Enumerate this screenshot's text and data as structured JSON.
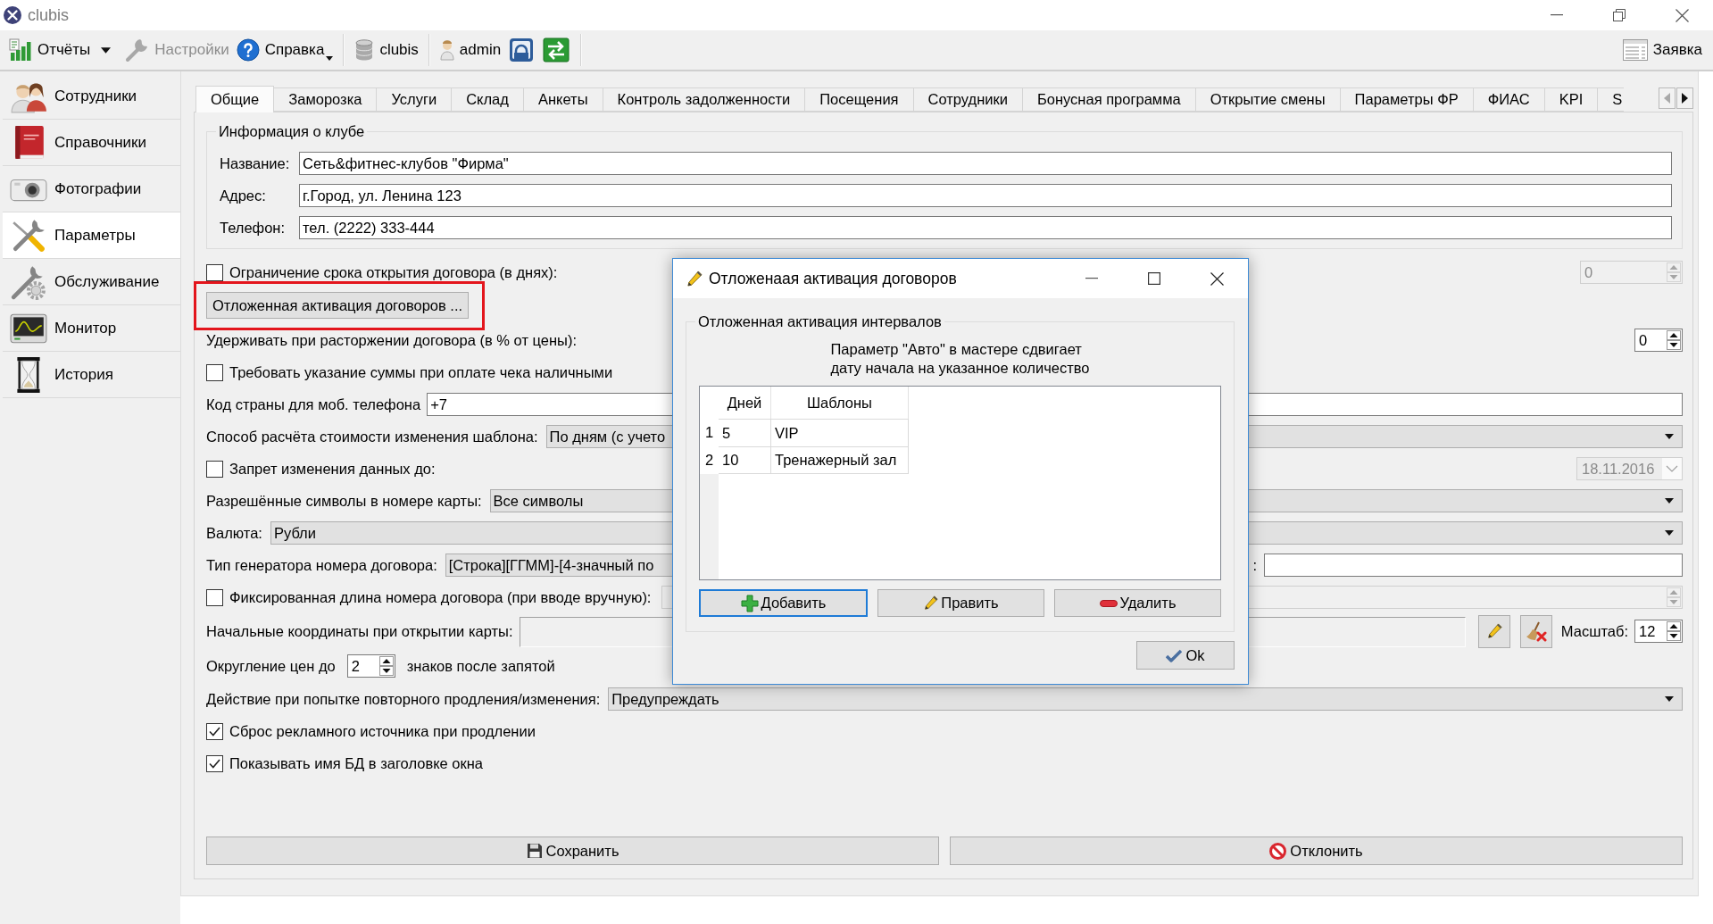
{
  "window": {
    "title": "clubis"
  },
  "toolbar": {
    "items": [
      {
        "kind": "split",
        "label": "Отчёты",
        "disabled": false,
        "separator_before": false
      },
      {
        "kind": "plain",
        "label": "Настройки",
        "disabled": true,
        "separator_before": false
      },
      {
        "kind": "menu",
        "label": "Справка",
        "disabled": false,
        "separator_before": false
      },
      {
        "kind": "plain",
        "label": "clubis",
        "disabled": false,
        "separator_before": true
      },
      {
        "kind": "plain",
        "label": "admin",
        "disabled": false,
        "separator_before": true
      }
    ],
    "request": {
      "label": "Заявка"
    }
  },
  "sidebar": {
    "items": [
      {
        "label": "Сотрудники",
        "selected": false
      },
      {
        "label": "Справочники",
        "selected": false
      },
      {
        "label": "Фотографии",
        "selected": false
      },
      {
        "label": "Параметры",
        "selected": true
      },
      {
        "label": "Обслуживание",
        "selected": false
      },
      {
        "label": "Монитор",
        "selected": false
      },
      {
        "label": "История",
        "selected": false
      }
    ]
  },
  "tabs": {
    "items": [
      {
        "label": "Общие",
        "selected": true
      },
      {
        "label": "Заморозка",
        "selected": false
      },
      {
        "label": "Услуги",
        "selected": false
      },
      {
        "label": "Склад",
        "selected": false
      },
      {
        "label": "Анкеты",
        "selected": false
      },
      {
        "label": "Контроль задолженности",
        "selected": false
      },
      {
        "label": "Посещения",
        "selected": false
      },
      {
        "label": "Сотрудники",
        "selected": false
      },
      {
        "label": "Бонусная программа",
        "selected": false
      },
      {
        "label": "Открытие смены",
        "selected": false
      },
      {
        "label": "Параметры ФР",
        "selected": false
      },
      {
        "label": "ФИАС",
        "selected": false
      },
      {
        "label": "KPI",
        "selected": false
      },
      {
        "label": "S",
        "selected": false
      }
    ],
    "scroll_left_enabled": false,
    "scroll_right_enabled": true
  },
  "club_info": {
    "title": "Информация о клубе",
    "fields": [
      {
        "label": "Название:",
        "value": "Сеть&фитнес-клубов \"Фирма\""
      },
      {
        "label": "Адрес:",
        "value": "г.Город, ул. Ленина 123"
      },
      {
        "label": "Телефон:",
        "value": "тел. (2222) 333-444"
      }
    ]
  },
  "settings": [
    {
      "kind": "check",
      "label": "Ограничение срока открытия договора (в днях):",
      "checked": false,
      "spin": {
        "value": "0",
        "disabled": true
      }
    },
    {
      "kind": "button",
      "label": "Отложенная активация договоров ...",
      "highlighted": true
    },
    {
      "kind": "spin",
      "label": "Удерживать при расторжении договора (в % от цены):",
      "spin": {
        "value": "0",
        "disabled": false
      }
    },
    {
      "kind": "check",
      "label": "Требовать указание суммы при оплате чека наличными",
      "checked": false
    },
    {
      "kind": "text",
      "label": "Код страны для моб. телефона",
      "value": "+7"
    },
    {
      "kind": "combo",
      "label": "Способ расчёта стоимости изменения шаблона:",
      "value": "По дням (с учето"
    },
    {
      "kind": "check",
      "label": "Запрет изменения данных до:",
      "checked": false,
      "date": {
        "value": "18.11.2016",
        "disabled": true
      }
    },
    {
      "kind": "combo",
      "label": "Разрешённые символы в номере карты:",
      "value": "Все символы"
    },
    {
      "kind": "combo",
      "label": "Валюта:",
      "value": "Рубли"
    },
    {
      "kind": "combo",
      "label": "Тип генератора номера договора:",
      "value": "[Строка][ГГММ]-[4-значный по",
      "side_field": {
        "label": ":"
      }
    },
    {
      "kind": "check_field",
      "label": "Фиксированная длина номера договора (при вводе вручную):",
      "checked": false,
      "spin": {
        "disabled": true
      }
    },
    {
      "kind": "coords",
      "label": "Начальные координаты при открытии карты:",
      "scale_label": "Масштаб:",
      "scale": "12"
    },
    {
      "kind": "rounding",
      "label": "Округление цен до",
      "value": "2",
      "suffix": "знаков после запятой"
    },
    {
      "kind": "combo",
      "label": "Действие при попытке повторного продления/изменения:",
      "value": "Предупреждать"
    },
    {
      "kind": "check",
      "label": "Сброс рекламного источника при продлении",
      "checked": true
    },
    {
      "kind": "check",
      "label": "Показывать имя БД в заголовке окна",
      "checked": true
    }
  ],
  "buttons": [
    {
      "kind": "save",
      "label": "Сохранить"
    },
    {
      "kind": "cancel",
      "label": "Отклонить"
    }
  ],
  "dialog": {
    "title": "Отложенаая активация договоров",
    "group": {
      "title": "Отложенная активация интервалов",
      "note": "Параметр \"Авто\" в мастере сдвигает\nдату начала на указанное количество",
      "table": {
        "columns": [
          "Дней",
          "Шаблоны"
        ],
        "rows": [
          {
            "number": "1",
            "cells": [
              "5",
              "VIP"
            ]
          },
          {
            "number": "2",
            "cells": [
              "10",
              "Тренажерный зал"
            ]
          }
        ]
      },
      "buttons": [
        {
          "kind": "add",
          "label": "Добавить",
          "focused": true
        },
        {
          "kind": "edit",
          "label": "Править",
          "focused": false
        },
        {
          "kind": "delete",
          "label": "Удалить",
          "focused": false
        }
      ]
    },
    "ok": {
      "label": "Ok"
    }
  }
}
